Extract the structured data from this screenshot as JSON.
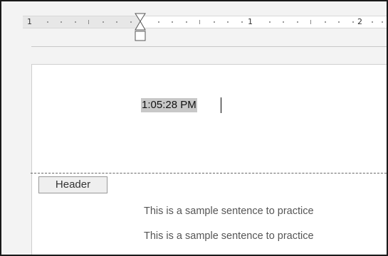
{
  "ruler": {
    "labels": [
      "1",
      "1",
      "2"
    ]
  },
  "header": {
    "time_value": "1:05:28 PM",
    "tab_label": "Header"
  },
  "body": {
    "lines": [
      "This is a sample sentence to practice",
      "This is a sample sentence to practice"
    ]
  }
}
